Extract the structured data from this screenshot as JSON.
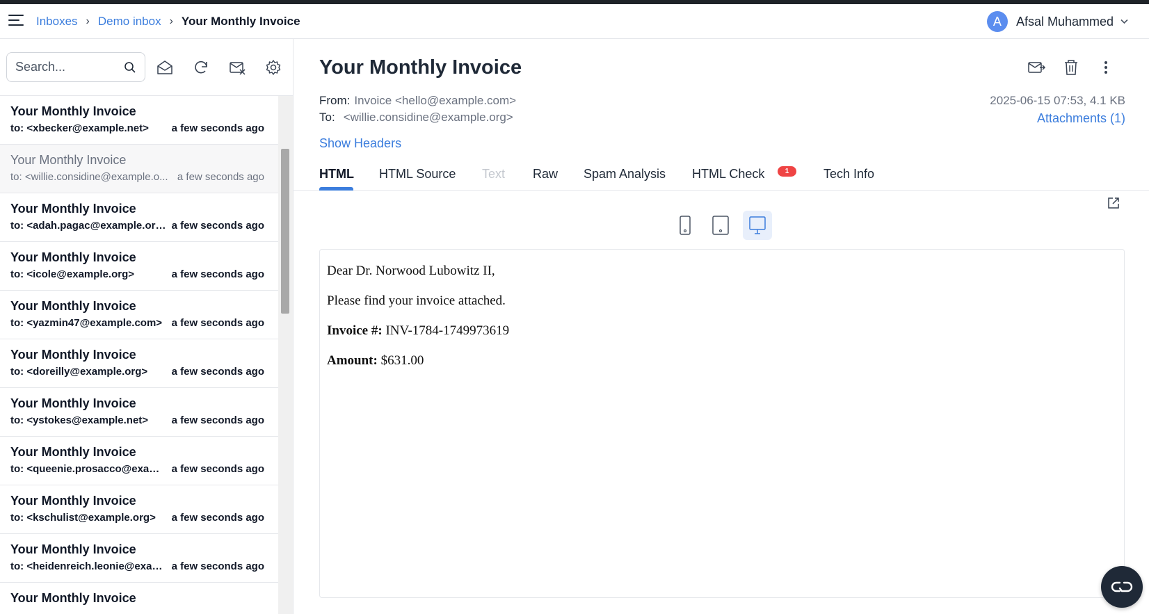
{
  "breadcrumb": {
    "inboxes": "Inboxes",
    "inbox": "Demo inbox",
    "current": "Your Monthly Invoice",
    "sep": "›"
  },
  "user": {
    "initial": "A",
    "name": "Afsal Muhammed"
  },
  "search": {
    "placeholder": "Search..."
  },
  "messages": [
    {
      "subject": "Your Monthly Invoice",
      "to": "to: <xbecker@example.net>",
      "time": "a few seconds ago",
      "read": false
    },
    {
      "subject": "Your Monthly Invoice",
      "to": "to: <willie.considine@example.o...",
      "time": "a few seconds ago",
      "read": true
    },
    {
      "subject": "Your Monthly Invoice",
      "to": "to: <adah.pagac@example.org>",
      "time": "a few seconds ago",
      "read": false
    },
    {
      "subject": "Your Monthly Invoice",
      "to": "to: <icole@example.org>",
      "time": "a few seconds ago",
      "read": false
    },
    {
      "subject": "Your Monthly Invoice",
      "to": "to: <yazmin47@example.com>",
      "time": "a few seconds ago",
      "read": false
    },
    {
      "subject": "Your Monthly Invoice",
      "to": "to: <doreilly@example.org>",
      "time": "a few seconds ago",
      "read": false
    },
    {
      "subject": "Your Monthly Invoice",
      "to": "to: <ystokes@example.net>",
      "time": "a few seconds ago",
      "read": false
    },
    {
      "subject": "Your Monthly Invoice",
      "to": "to: <queenie.prosacco@exam...",
      "time": "a few seconds ago",
      "read": false
    },
    {
      "subject": "Your Monthly Invoice",
      "to": "to: <kschulist@example.org>",
      "time": "a few seconds ago",
      "read": false
    },
    {
      "subject": "Your Monthly Invoice",
      "to": "to: <heidenreich.leonie@exam...",
      "time": "a few seconds ago",
      "read": false
    },
    {
      "subject": "Your Monthly Invoice",
      "to": "",
      "time": "",
      "read": false
    }
  ],
  "message": {
    "title": "Your Monthly Invoice",
    "from_label": "From:",
    "from_value": "Invoice <hello@example.com>",
    "to_label": "To:",
    "to_value": "<willie.considine@example.org>",
    "meta": "2025-06-15 07:53, 4.1 KB",
    "attachments": "Attachments (1)",
    "show_headers": "Show Headers"
  },
  "tabs": {
    "html": "HTML",
    "html_source": "HTML Source",
    "text": "Text",
    "raw": "Raw",
    "spam": "Spam Analysis",
    "html_check": "HTML Check",
    "html_check_badge": "1",
    "tech_info": "Tech Info"
  },
  "preview": {
    "greeting": "Dear Dr. Norwood Lubowitz II,",
    "line": "Please find your invoice attached.",
    "invoice_label": "Invoice #:",
    "invoice_value": "INV-1784-1749973619",
    "amount_label": "Amount:",
    "amount_value": "$631.00"
  },
  "colors": {
    "accent": "#3b7ddd",
    "badge": "#ef4444",
    "topbar": "#1f2328"
  },
  "icons": {
    "menu": "hamburger-icon",
    "search": "search-icon",
    "mark_read": "envelope-open-icon",
    "refresh": "refresh-icon",
    "clear": "mail-x-icon",
    "settings": "gear-icon",
    "forward": "mail-forward-icon",
    "delete": "trash-icon",
    "more": "more-vertical-icon",
    "external": "external-link-icon",
    "phone": "phone-icon",
    "tablet": "tablet-icon",
    "desktop": "desktop-icon",
    "chat": "chat-icon"
  }
}
